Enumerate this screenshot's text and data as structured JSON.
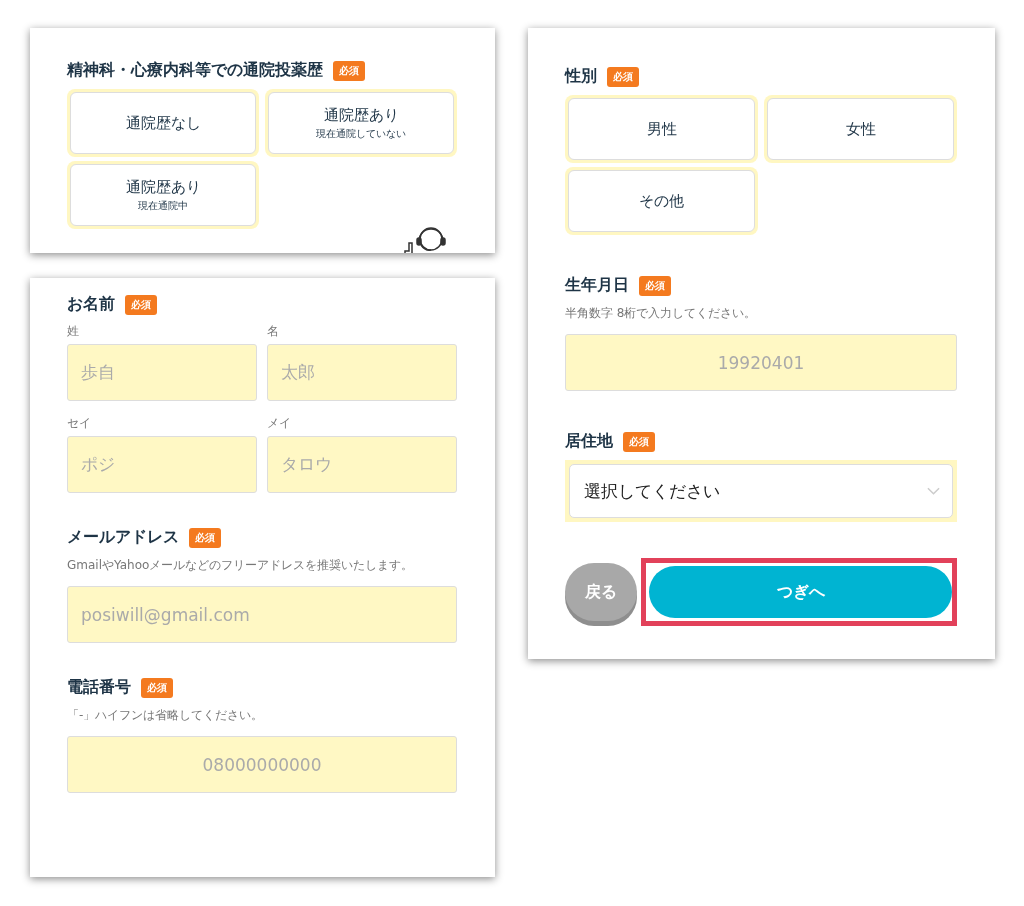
{
  "cards": [
    {
      "sections": [
        {
          "kind": "choices",
          "title": "精神科・心療内科等での通院投薬歴",
          "badge": "必須",
          "options": [
            {
              "label": "通院歴なし",
              "selected": false
            },
            {
              "label": "通院歴あり",
              "sublabel": "現在通院していない",
              "selected": false
            },
            {
              "label": "通院歴あり",
              "sublabel": "現在通院中",
              "selected": false
            }
          ]
        }
      ]
    },
    {
      "sections": [
        {
          "kind": "name_fields",
          "title": "お名前",
          "badge": "必須",
          "fields": [
            {
              "label": "姓",
              "placeholder": "歩自"
            },
            {
              "label": "名",
              "placeholder": "太郎"
            },
            {
              "label": "セイ",
              "placeholder": "ポジ"
            },
            {
              "label": "メイ",
              "placeholder": "タロウ"
            }
          ]
        },
        {
          "kind": "text_field",
          "title": "メールアドレス",
          "badge": "必須",
          "hint": "GmailやYahooメールなどのフリーアドレスを推奨いたします。",
          "placeholder": "posiwill@gmail.com",
          "centered": false
        },
        {
          "kind": "text_field",
          "title": "電話番号",
          "badge": "必須",
          "hint": "「-」ハイフンは省略してください。",
          "placeholder": "08000000000",
          "centered": true
        }
      ]
    },
    {
      "sections": [
        {
          "kind": "choices",
          "title": "性別",
          "badge": "必須",
          "options": [
            {
              "label": "男性",
              "selected": false
            },
            {
              "label": "女性",
              "selected": false
            },
            {
              "label": "その他",
              "selected": false
            }
          ]
        },
        {
          "kind": "text_field",
          "title": "生年月日",
          "badge": "必須",
          "hint": "半角数字 8桁で入力してください。",
          "placeholder": "19920401",
          "centered": true
        },
        {
          "kind": "select",
          "title": "居住地",
          "badge": "必須",
          "value": "選択してください"
        }
      ],
      "buttons": {
        "back": "戻る",
        "next": "つぎへ",
        "next_highlighted": true
      }
    }
  ]
}
